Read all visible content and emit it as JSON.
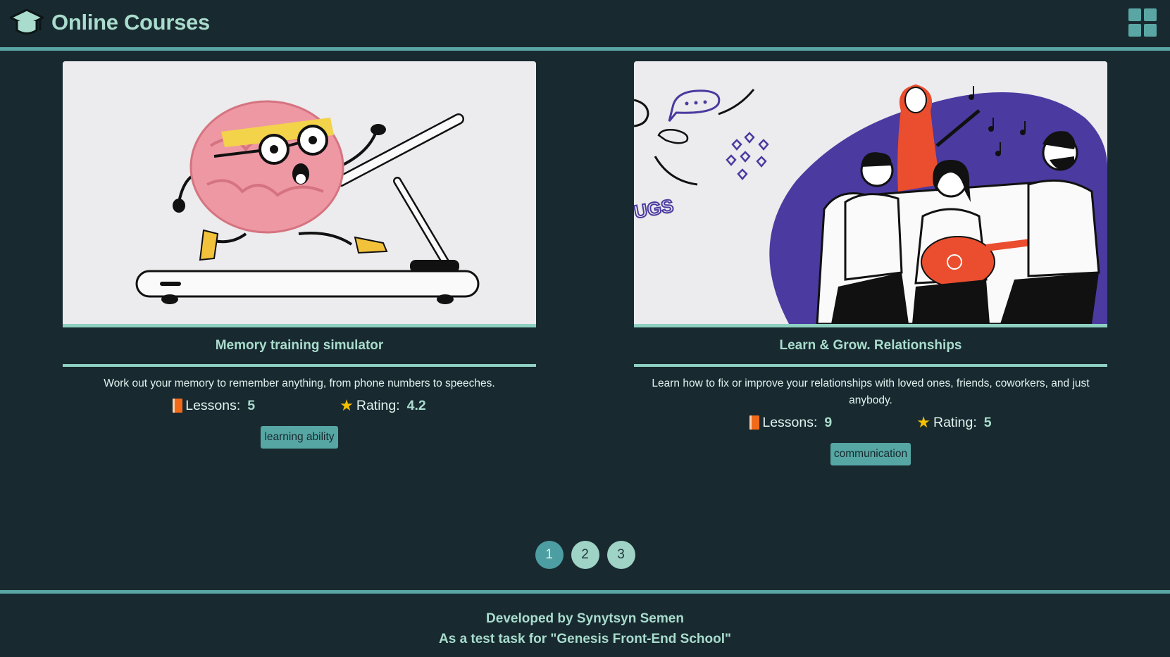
{
  "header": {
    "title": "Online Courses",
    "logo_icon": "graduation-cap-icon",
    "view_toggle_icon": "grid-view-icon"
  },
  "courses": [
    {
      "title": "Memory training simulator",
      "description": "Work out your memory to remember anything, from phone numbers to speeches.",
      "lessons_label": "Lessons:",
      "lessons": "5",
      "rating_label": "Rating:",
      "rating": "4.2",
      "tags": [
        "learning ability"
      ],
      "image_icon": "brain-on-treadmill-illustration"
    },
    {
      "title": "Learn & Grow. Relationships",
      "description": "Learn how to fix or improve your relationships with loved ones, friends, coworkers, and just anybody.",
      "lessons_label": "Lessons:",
      "lessons": "9",
      "rating_label": "Rating:",
      "rating": "5",
      "tags": [
        "communication"
      ],
      "image_icon": "friends-singing-illustration"
    }
  ],
  "pagination": {
    "pages": [
      "1",
      "2",
      "3"
    ],
    "current": "1"
  },
  "footer": {
    "line1": "Developed by Synytsyn Semen",
    "line2": "As a test task for \"Genesis Front-End School\""
  },
  "colors": {
    "background": "#182a30",
    "accent": "#5aa6a4",
    "title_text": "#a9dccd",
    "tag_bg": "#56a6a4",
    "illustration_purple": "#4b3aa0",
    "illustration_orange": "#ea4e2e"
  }
}
